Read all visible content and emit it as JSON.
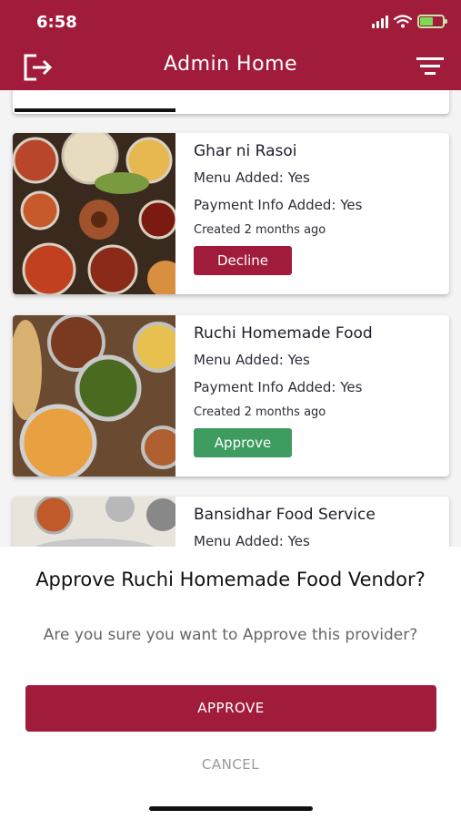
{
  "status_bar": {
    "time": "6:58"
  },
  "header": {
    "title": "Admin Home",
    "logout_icon": "logout-icon",
    "filter_icon": "filter-icon",
    "bg_color": "#a11c3a"
  },
  "vendors": [
    {
      "name": "Ghar ni Rasoi",
      "menu": "Menu Added: Yes",
      "payment": "Payment Info Added: Yes",
      "created": "Created 2 months ago",
      "action": "Decline"
    },
    {
      "name": "Ruchi Homemade Food",
      "menu": "Menu Added: Yes",
      "payment": "Payment Info Added: Yes",
      "created": "Created 2 months ago",
      "action": "Approve"
    },
    {
      "name": "Bansidhar Food Service",
      "menu": "Menu Added: Yes"
    }
  ],
  "dialog": {
    "title": "Approve Ruchi Homemade Food Vendor?",
    "message": "Are you sure you want to Approve this provider?",
    "confirm_label": "APPROVE",
    "cancel_label": "CANCEL"
  },
  "colors": {
    "accent": "#a11c3a",
    "approve": "#3e9c60"
  }
}
